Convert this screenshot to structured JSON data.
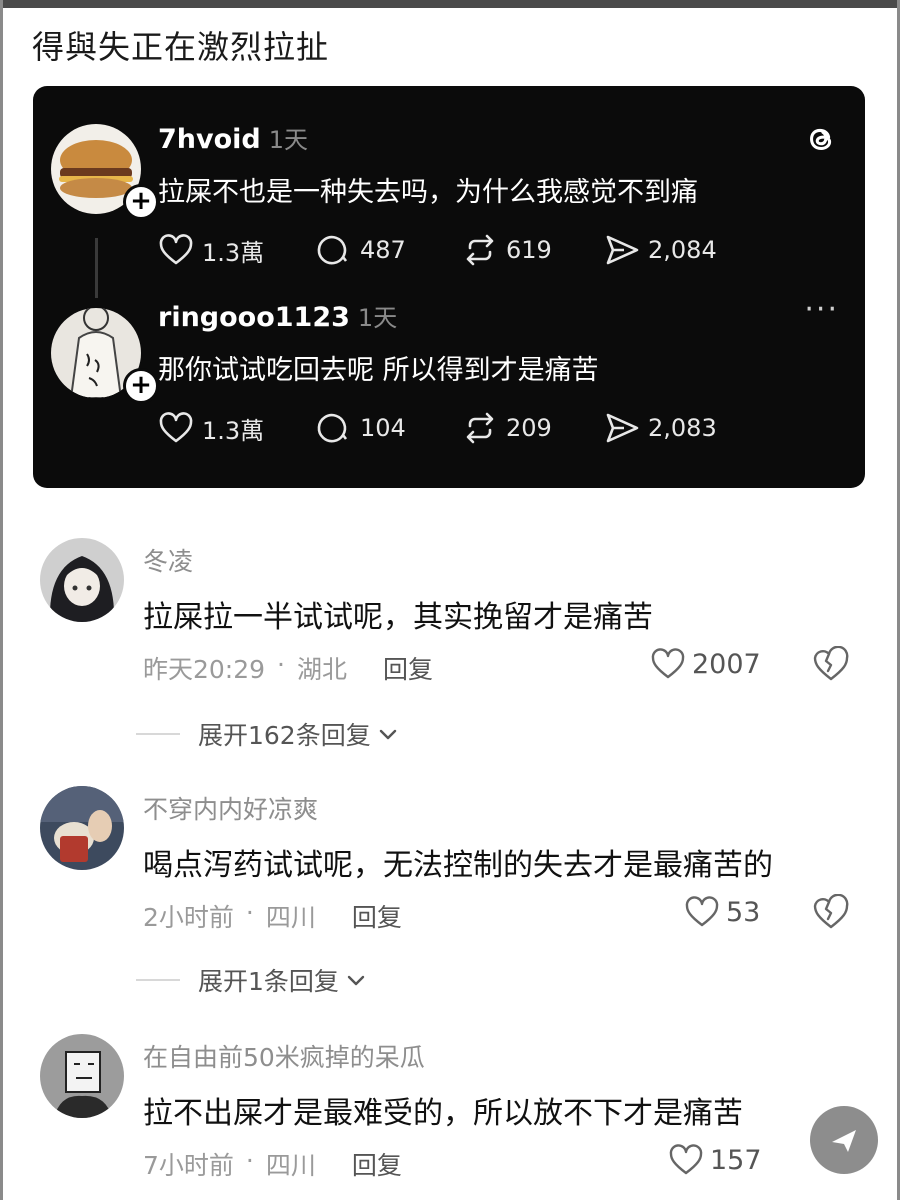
{
  "page_title": "得與失正在激烈拉扯",
  "threads": {
    "posts": [
      {
        "username": "7hvoid",
        "time": "1天",
        "text": "拉屎不也是一种失去吗，为什么我感觉不到痛",
        "likes": "1.3萬",
        "replies": "487",
        "reposts": "619",
        "shares": "2,084"
      },
      {
        "username": "ringooo1123",
        "time": "1天",
        "text": "那你试试吃回去呢 所以得到才是痛苦",
        "likes": "1.3萬",
        "replies": "104",
        "reposts": "209",
        "shares": "2,083",
        "more": "···"
      }
    ]
  },
  "comments": [
    {
      "name": "冬凌",
      "text": "拉屎拉一半试试呢，其实挽留才是痛苦",
      "time": "昨天20:29",
      "sep": "·",
      "location": "湖北",
      "reply_label": "回复",
      "likes": "2007",
      "expand_label": "展开162条回复"
    },
    {
      "name": "不穿内内好凉爽",
      "text": "喝点泻药试试呢，无法控制的失去才是最痛苦的",
      "time": "2小时前",
      "sep": "·",
      "location": "四川",
      "reply_label": "回复",
      "likes": "53",
      "expand_label": "展开1条回复"
    },
    {
      "name": "在自由前50米疯掉的呆瓜",
      "text": "拉不出屎才是最难受的，所以放不下才是痛苦",
      "time": "7小时前",
      "sep": "·",
      "location": "四川",
      "reply_label": "回复",
      "likes": "157"
    }
  ]
}
